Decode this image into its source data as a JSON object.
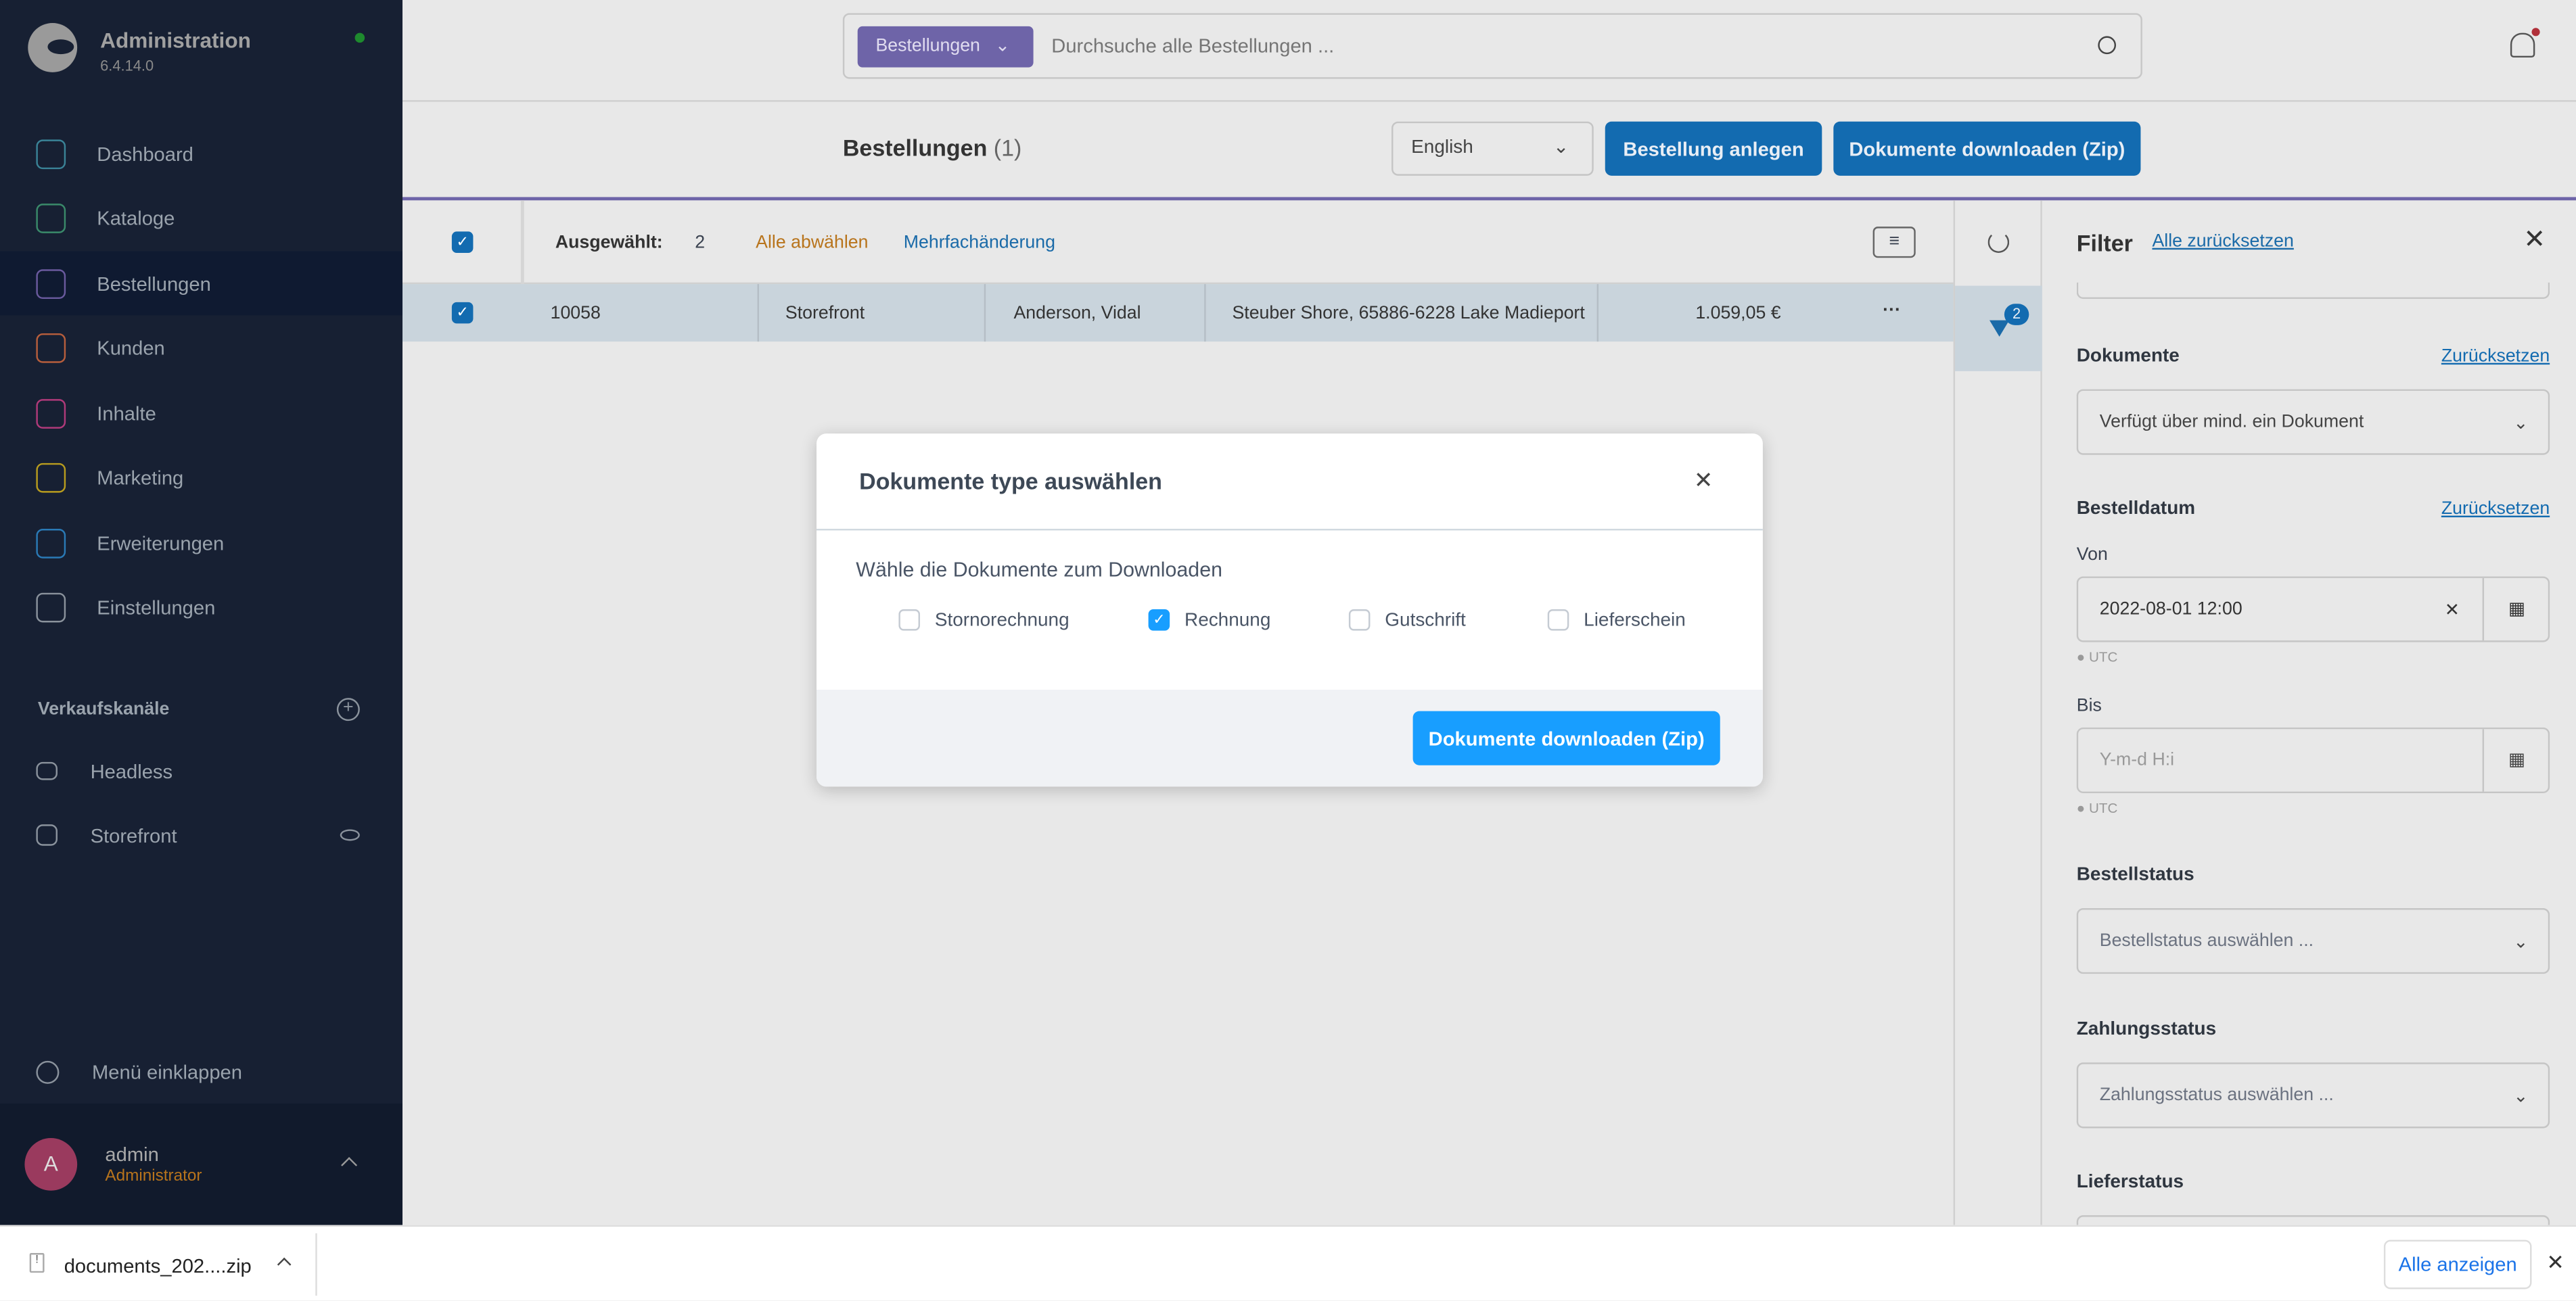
{
  "app": {
    "title": "Administration",
    "version": "6.4.14.0"
  },
  "sidebar": {
    "items": [
      {
        "label": "Dashboard",
        "icon": "gauge-icon",
        "color": "#3a8397"
      },
      {
        "label": "Kataloge",
        "icon": "catalog-icon",
        "color": "#3a8a6a"
      },
      {
        "label": "Bestellungen",
        "icon": "shopping-bag-icon",
        "color": "#6a5a9e"
      },
      {
        "label": "Kunden",
        "icon": "users-icon",
        "color": "#b75e3c"
      },
      {
        "label": "Inhalte",
        "icon": "content-icon",
        "color": "#b03a7a"
      },
      {
        "label": "Marketing",
        "icon": "megaphone-icon",
        "color": "#b89c1e"
      },
      {
        "label": "Erweiterungen",
        "icon": "plug-icon",
        "color": "#2a7ab6"
      },
      {
        "label": "Einstellungen",
        "icon": "gear-icon",
        "color": "#8a929c"
      }
    ],
    "sales_channels_title": "Verkaufskanäle",
    "sales_channels": [
      {
        "label": "Headless",
        "icon": "basket-icon"
      },
      {
        "label": "Storefront",
        "icon": "storefront-icon"
      }
    ],
    "collapse": "Menü einklappen",
    "user": {
      "initial": "A",
      "name": "admin",
      "role": "Administrator"
    }
  },
  "search": {
    "type": "Bestellungen",
    "placeholder": "Durchsuche alle Bestellungen ..."
  },
  "header": {
    "title": "Bestellungen",
    "count": "(1)",
    "language": "English",
    "create": "Bestellung anlegen",
    "download": "Dokumente downloaden (Zip)"
  },
  "bulk": {
    "selected_label": "Ausgewählt:",
    "selected_count": "2",
    "deselect": "Alle abwählen",
    "bulk_edit": "Mehrfachänderung"
  },
  "table": {
    "rows": [
      {
        "number": "10058",
        "channel": "Storefront",
        "customer": "Anderson, Vidal",
        "address": "Steuber Shore, 65886-6228 Lake Madieport",
        "amount": "1.059,05 €"
      }
    ],
    "more": "···"
  },
  "filter_badge": "2",
  "filter": {
    "title": "Filter",
    "reset_all": "Alle zurücksetzen",
    "reset": "Zurücksetzen",
    "documents_label": "Dokumente",
    "documents_value": "Verfügt über mind. ein Dokument",
    "date_label": "Bestelldatum",
    "from_label": "Von",
    "from_value": "2022-08-01 12:00",
    "to_label": "Bis",
    "to_placeholder": "Y-m-d H:i",
    "tz": "UTC",
    "status_label": "Bestellstatus",
    "status_placeholder": "Bestellstatus auswählen ...",
    "payment_label": "Zahlungsstatus",
    "payment_placeholder": "Zahlungsstatus auswählen ...",
    "delivery_label": "Lieferstatus"
  },
  "modal": {
    "title": "Dokumente type auswählen",
    "intro": "Wähle die Dokumente zum Downloaden",
    "options": [
      {
        "label": "Stornorechnung",
        "checked": false
      },
      {
        "label": "Rechnung",
        "checked": true
      },
      {
        "label": "Gutschrift",
        "checked": false
      },
      {
        "label": "Lieferschein",
        "checked": false
      }
    ],
    "button": "Dokumente downloaden (Zip)"
  },
  "download_bar": {
    "file": "documents_202....zip",
    "show_all": "Alle anzeigen"
  }
}
